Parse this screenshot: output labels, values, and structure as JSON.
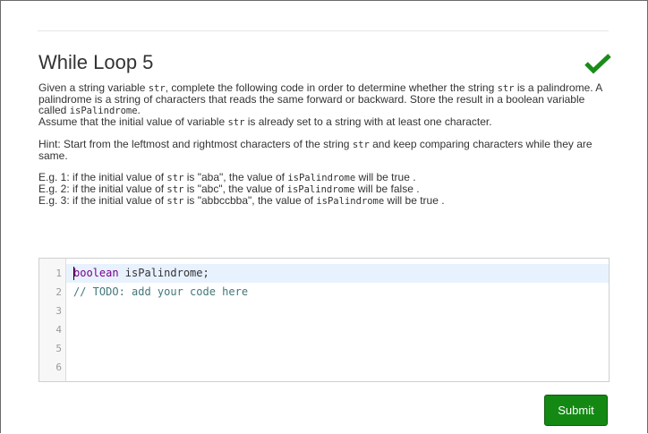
{
  "title": "While Loop 5",
  "status_icon": "check-icon",
  "colors": {
    "success": "#1a8c1a",
    "submit_bg": "#138913",
    "keyword": "#770088",
    "comment": "#44777a"
  },
  "description": {
    "para1": {
      "t1": "Given a string variable ",
      "c1": "str",
      "t2": ", complete the following code in order to determine whether the string ",
      "c2": "str",
      "t3": " is a palindrome. A palindrome is a string of characters that reads the same forward or backward. Store the result in a boolean variable called ",
      "c3": "isPalindrome",
      "t4": "."
    },
    "para2": {
      "t1": "Assume that the initial value of variable ",
      "c1": "str",
      "t2": " is already set to a string with at least one character."
    },
    "hint": {
      "t1": "Hint: Start from the leftmost and rightmost characters of the string ",
      "c1": "str",
      "t2": " and keep comparing characters while they are same."
    },
    "examples": [
      {
        "t1": "E.g. 1: if the initial value of ",
        "c1": "str",
        "t2": " is \"aba\", the value of ",
        "c2": "isPalindrome",
        "t3": " will be true ."
      },
      {
        "t1": "E.g. 2: if the initial value of ",
        "c1": "str",
        "t2": " is \"abc\", the value of ",
        "c2": "isPalindrome",
        "t3": " will be false ."
      },
      {
        "t1": "E.g. 3: if the initial value of ",
        "c1": "str",
        "t2": " is \"abbccbba\", the value of ",
        "c2": "isPalindrome",
        "t3": " will be true ."
      }
    ]
  },
  "editor": {
    "line_numbers": [
      "1",
      "2",
      "3",
      "4",
      "5",
      "6"
    ],
    "line1_keyword": "boolean",
    "line1_rest": " isPalindrome;",
    "line2_comment": "// TODO: add your code here"
  },
  "submit_label": "Submit"
}
